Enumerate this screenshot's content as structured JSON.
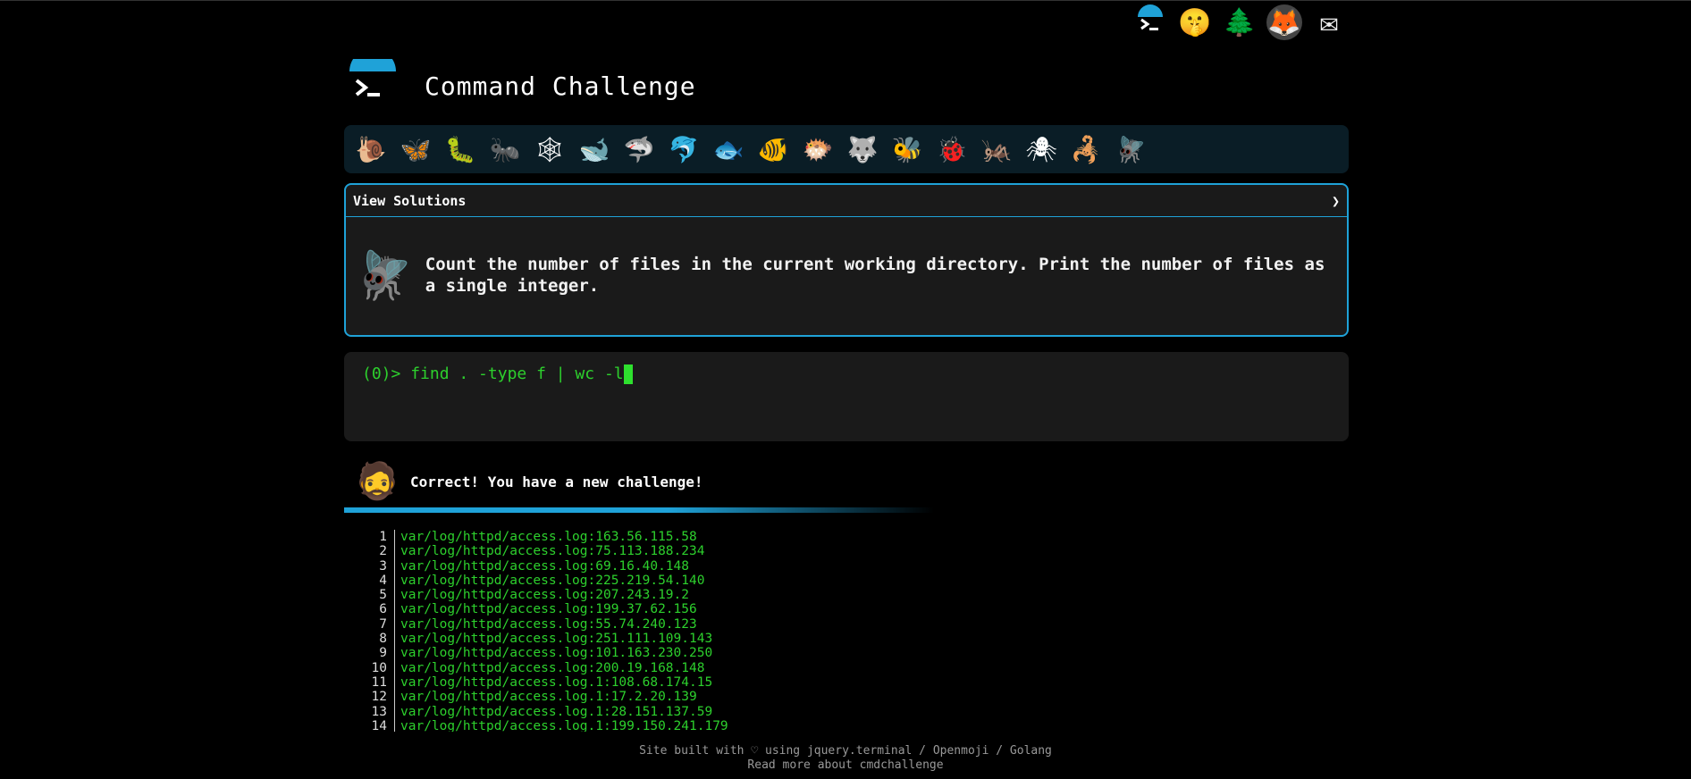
{
  "top_icons": [
    {
      "name": "terminal-icon",
      "glyph": "▶"
    },
    {
      "name": "shushing-face-icon",
      "glyph": "🤫"
    },
    {
      "name": "tree-icon",
      "glyph": "🌲"
    },
    {
      "name": "gitlab-icon",
      "glyph": "🦊"
    },
    {
      "name": "mail-icon",
      "glyph": "✉"
    }
  ],
  "header": {
    "title": "Command Challenge"
  },
  "creatures": [
    "🐌",
    "🦋",
    "🐛",
    "🐜",
    "🕸",
    "🐋",
    "🦈",
    "🐬",
    "🐟",
    "🐠",
    "🐡",
    "🐺",
    "🐝",
    "🐞",
    "🦗",
    "🕷",
    "🦂",
    "🪰"
  ],
  "solutions": {
    "label": "View Solutions",
    "chevron": "❯",
    "creature": "🪰",
    "description": "Count the number of files in the current working directory. Print the number of files as a single integer."
  },
  "terminal": {
    "prompt": "(0)>",
    "command": "find . -type f | wc -l"
  },
  "result": {
    "avatar": "🧔",
    "message": "Correct! You have a new challenge!"
  },
  "files": [
    {
      "n": "1",
      "v": "var/log/httpd/access.log:163.56.115.58"
    },
    {
      "n": "2",
      "v": "var/log/httpd/access.log:75.113.188.234"
    },
    {
      "n": "3",
      "v": "var/log/httpd/access.log:69.16.40.148"
    },
    {
      "n": "4",
      "v": "var/log/httpd/access.log:225.219.54.140"
    },
    {
      "n": "5",
      "v": "var/log/httpd/access.log:207.243.19.2"
    },
    {
      "n": "6",
      "v": "var/log/httpd/access.log:199.37.62.156"
    },
    {
      "n": "7",
      "v": "var/log/httpd/access.log:55.74.240.123"
    },
    {
      "n": "8",
      "v": "var/log/httpd/access.log:251.111.109.143"
    },
    {
      "n": "9",
      "v": "var/log/httpd/access.log:101.163.230.250"
    },
    {
      "n": "10",
      "v": "var/log/httpd/access.log:200.19.168.148"
    },
    {
      "n": "11",
      "v": "var/log/httpd/access.log.1:108.68.174.15"
    },
    {
      "n": "12",
      "v": "var/log/httpd/access.log.1:17.2.20.139"
    },
    {
      "n": "13",
      "v": "var/log/httpd/access.log.1:28.151.137.59"
    },
    {
      "n": "14",
      "v": "var/log/httpd/access.log.1:199.150.241.179"
    }
  ],
  "footer": {
    "line1": "Site built with ♡ using jquery.terminal / Openmoji / Golang",
    "line2": "Read more about cmdchallenge"
  },
  "colors": {
    "accent": "#1fa2d8",
    "terminal_green": "#2dd02d"
  }
}
